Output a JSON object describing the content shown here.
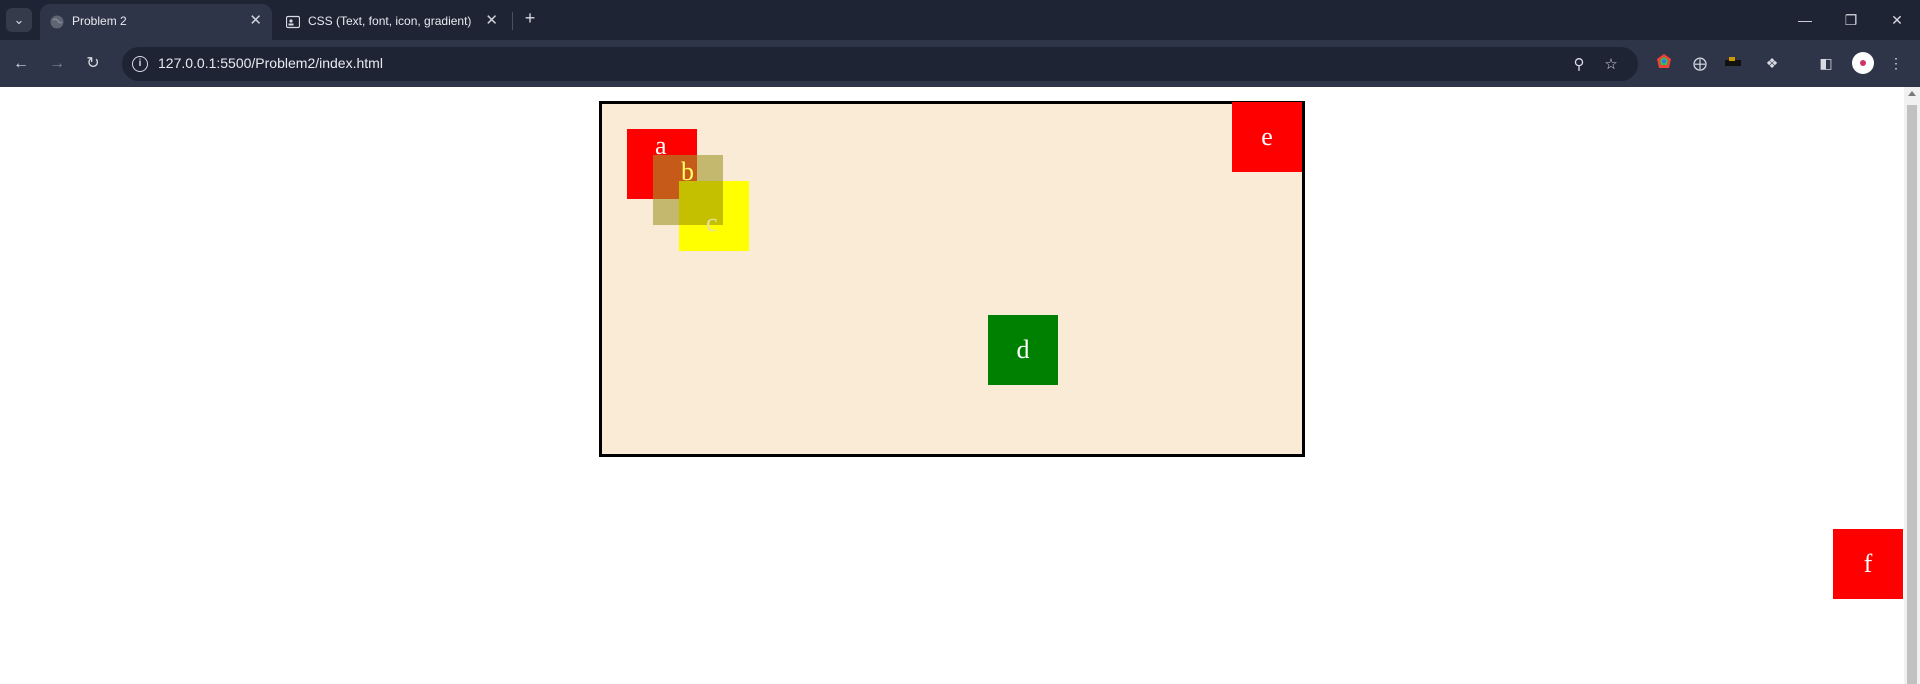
{
  "browser": {
    "tabs": [
      {
        "title": "Problem 2",
        "active": true
      },
      {
        "title": "CSS (Text, font, icon, gradient)",
        "active": false
      }
    ],
    "url": "127.0.0.1:5500/Problem2/index.html",
    "icons": {
      "tab_search": "chevron-down-icon",
      "close": "close-icon",
      "new_tab": "plus-icon",
      "back": "arrow-left-icon",
      "forward": "arrow-right-icon",
      "reload": "reload-icon",
      "info": "info-icon",
      "zoom": "zoom-icon",
      "bookmark": "star-icon",
      "menu": "kebab-menu-icon"
    },
    "colors": {
      "chrome_dark": "#1f2434",
      "chrome": "#2f3548"
    }
  },
  "page": {
    "container_bg": "#faebd7",
    "boxes": {
      "a": {
        "label": "a",
        "color": "#ff0000"
      },
      "b": {
        "label": "b",
        "color": "#a09628"
      },
      "c": {
        "label": "c",
        "color": "#ffff00"
      },
      "d": {
        "label": "d",
        "color": "#008000"
      },
      "e": {
        "label": "e",
        "color": "#ff0000"
      },
      "f": {
        "label": "f",
        "color": "#ff0000"
      }
    }
  }
}
